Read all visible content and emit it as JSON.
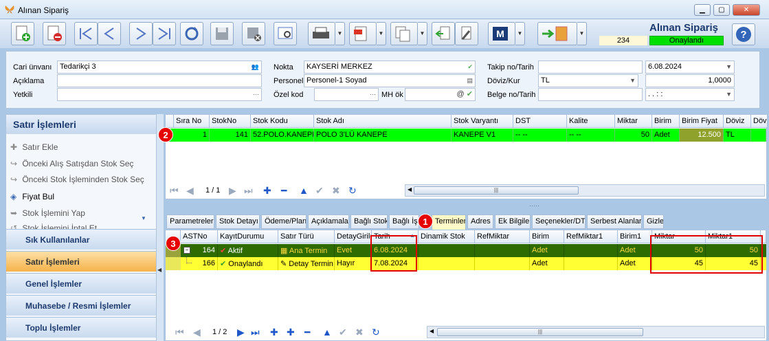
{
  "window": {
    "title": "Alınan Sipariş",
    "controls": [
      "minimize",
      "maximize",
      "close"
    ]
  },
  "toolbar": {
    "buttons": [
      {
        "icon": "new-document-icon"
      },
      {
        "icon": "delete-document-icon"
      },
      {
        "icon": "first-record-icon"
      },
      {
        "icon": "previous-record-icon"
      },
      {
        "icon": "next-record-icon"
      },
      {
        "icon": "last-record-icon"
      },
      {
        "icon": "refresh-icon"
      },
      {
        "icon": "save-icon"
      },
      {
        "icon": "save-close-icon"
      },
      {
        "icon": "preview-icon"
      },
      {
        "icon": "print-icon"
      },
      {
        "icon": "pdf-export-icon"
      },
      {
        "icon": "copy-document-icon"
      },
      {
        "icon": "import-icon"
      },
      {
        "icon": "tools-icon"
      },
      {
        "icon": "m-module-icon"
      },
      {
        "icon": "exit-door-icon"
      }
    ]
  },
  "header": {
    "title": "Alınan Sipariş",
    "code": "234",
    "status": "Onaylandı",
    "help_icon": "help-icon"
  },
  "form": {
    "cari_label": "Cari ünvanı",
    "cari_value": "Tedarikçi 3",
    "aciklama_label": "Açıklama",
    "aciklama_value": "",
    "yetkili_label": "Yetkili",
    "yetkili_value": "",
    "nokta_label": "Nokta",
    "nokta_value": "KAYSERİ MERKEZ",
    "personel_label": "Personel",
    "personel_value": "Personel-1 Soyad",
    "ozelkod_label": "Özel kod",
    "ozelkod_value": "",
    "mhok_label": "MH ök",
    "mhok_value": "",
    "takip_label": "Takip no/Tarih",
    "takip_value": "",
    "takip_date": "6.08.2024",
    "doviz_label": "Döviz/Kur",
    "doviz_value": "TL",
    "kur_value": "1,0000",
    "belge_label": "Belge no/Tarih",
    "belge_value": "",
    "belge_date": ". .    :  :"
  },
  "left_panel": {
    "title": "Satır İşlemleri",
    "actions": [
      {
        "label": "Satır Ekle",
        "icon": "plus-icon",
        "enabled": false
      },
      {
        "label": "Önceki Alış Satışdan Stok Seç",
        "icon": "return-arrow-icon",
        "enabled": false
      },
      {
        "label": "Önceki Stok İşleminden Stok Seç",
        "icon": "return-arrow-icon",
        "enabled": false
      },
      {
        "label": "Fiyat Bul",
        "icon": "price-tag-icon",
        "enabled": true
      },
      {
        "label": "Stok İşlemini Yap",
        "icon": "forward-arrow-icon",
        "enabled": false
      },
      {
        "label": "Stok İşlemini İptal Et",
        "icon": "cancel-icon",
        "enabled": false
      }
    ],
    "nav": [
      {
        "label": "Sık Kullanılanlar",
        "selected": false
      },
      {
        "label": "Satır İşlemleri",
        "selected": true
      },
      {
        "label": "Genel İşlemler",
        "selected": false
      },
      {
        "label": "Muhasebe / Resmi İşlemler",
        "selected": false
      },
      {
        "label": "Toplu İşlemler",
        "selected": false
      }
    ]
  },
  "lines_grid": {
    "columns": [
      "Sıra No",
      "StokNo",
      "Stok Kodu",
      "Stok Adı",
      "Stok Varyantı",
      "DST",
      "Kalite",
      "Miktar",
      "Birim",
      "Birim Fiyat",
      "Döviz",
      "Döv"
    ],
    "rows": [
      {
        "sira": "1",
        "stokno": "141",
        "stokkodu": "52.POLO.KANEPE",
        "stokadi": "POLO 3'LÜ KANEPE",
        "varyant": "KANEPE V1",
        "dst": "-- --",
        "kalite": "-- --",
        "miktar": "50",
        "birim": "Adet",
        "fiyat": "12.500",
        "doviz": "TL",
        "dov": ""
      }
    ],
    "page": "1 / 1"
  },
  "tabs": [
    "Parametreler",
    "Stok Detayı",
    "Ödeme/Plan",
    "Açıklamalar",
    "Bağlı Stok",
    "Bağlı İş",
    "Terminler",
    "Adres",
    "Ek Bilgiler",
    "Seçenekler/DT",
    "Serbest Alanlar",
    "Gizle"
  ],
  "active_tab": "Terminler",
  "termin_grid": {
    "columns": [
      "ASTNo",
      "KayıtDurumu",
      "Satır Türü",
      "DetayGirile",
      "Tarih",
      "Dinamik Stok",
      "RefMiktar",
      "Birim",
      "RefMiktar1",
      "Birim1",
      "Miktar",
      "Miktar1"
    ],
    "rows": [
      {
        "astno": "164",
        "durum": "Aktif",
        "tur": "Ana Termin",
        "detay": "Evet",
        "tarih": "6.08.2024",
        "dinamik": "",
        "refmiktar": "",
        "birim": "Adet",
        "refmiktar1": "",
        "birim1": "Adet",
        "miktar": "50",
        "miktar1": "50"
      },
      {
        "astno": "166",
        "durum": "Onaylandı",
        "tur": "Detay Termin",
        "detay": "Hayır",
        "tarih": "7.08.2024",
        "dinamik": "",
        "refmiktar": "",
        "birim": "Adet",
        "refmiktar1": "",
        "birim1": "Adet",
        "miktar": "45",
        "miktar1": "45"
      }
    ],
    "page": "1 / 2"
  },
  "annotations": [
    "1",
    "2",
    "3"
  ],
  "colors": {
    "accent": "#1c3a6e",
    "active_row": "#00ff00",
    "termin_row1": "#2e6b00",
    "termin_row2": "#ffff33",
    "highlight": "#e00000"
  }
}
